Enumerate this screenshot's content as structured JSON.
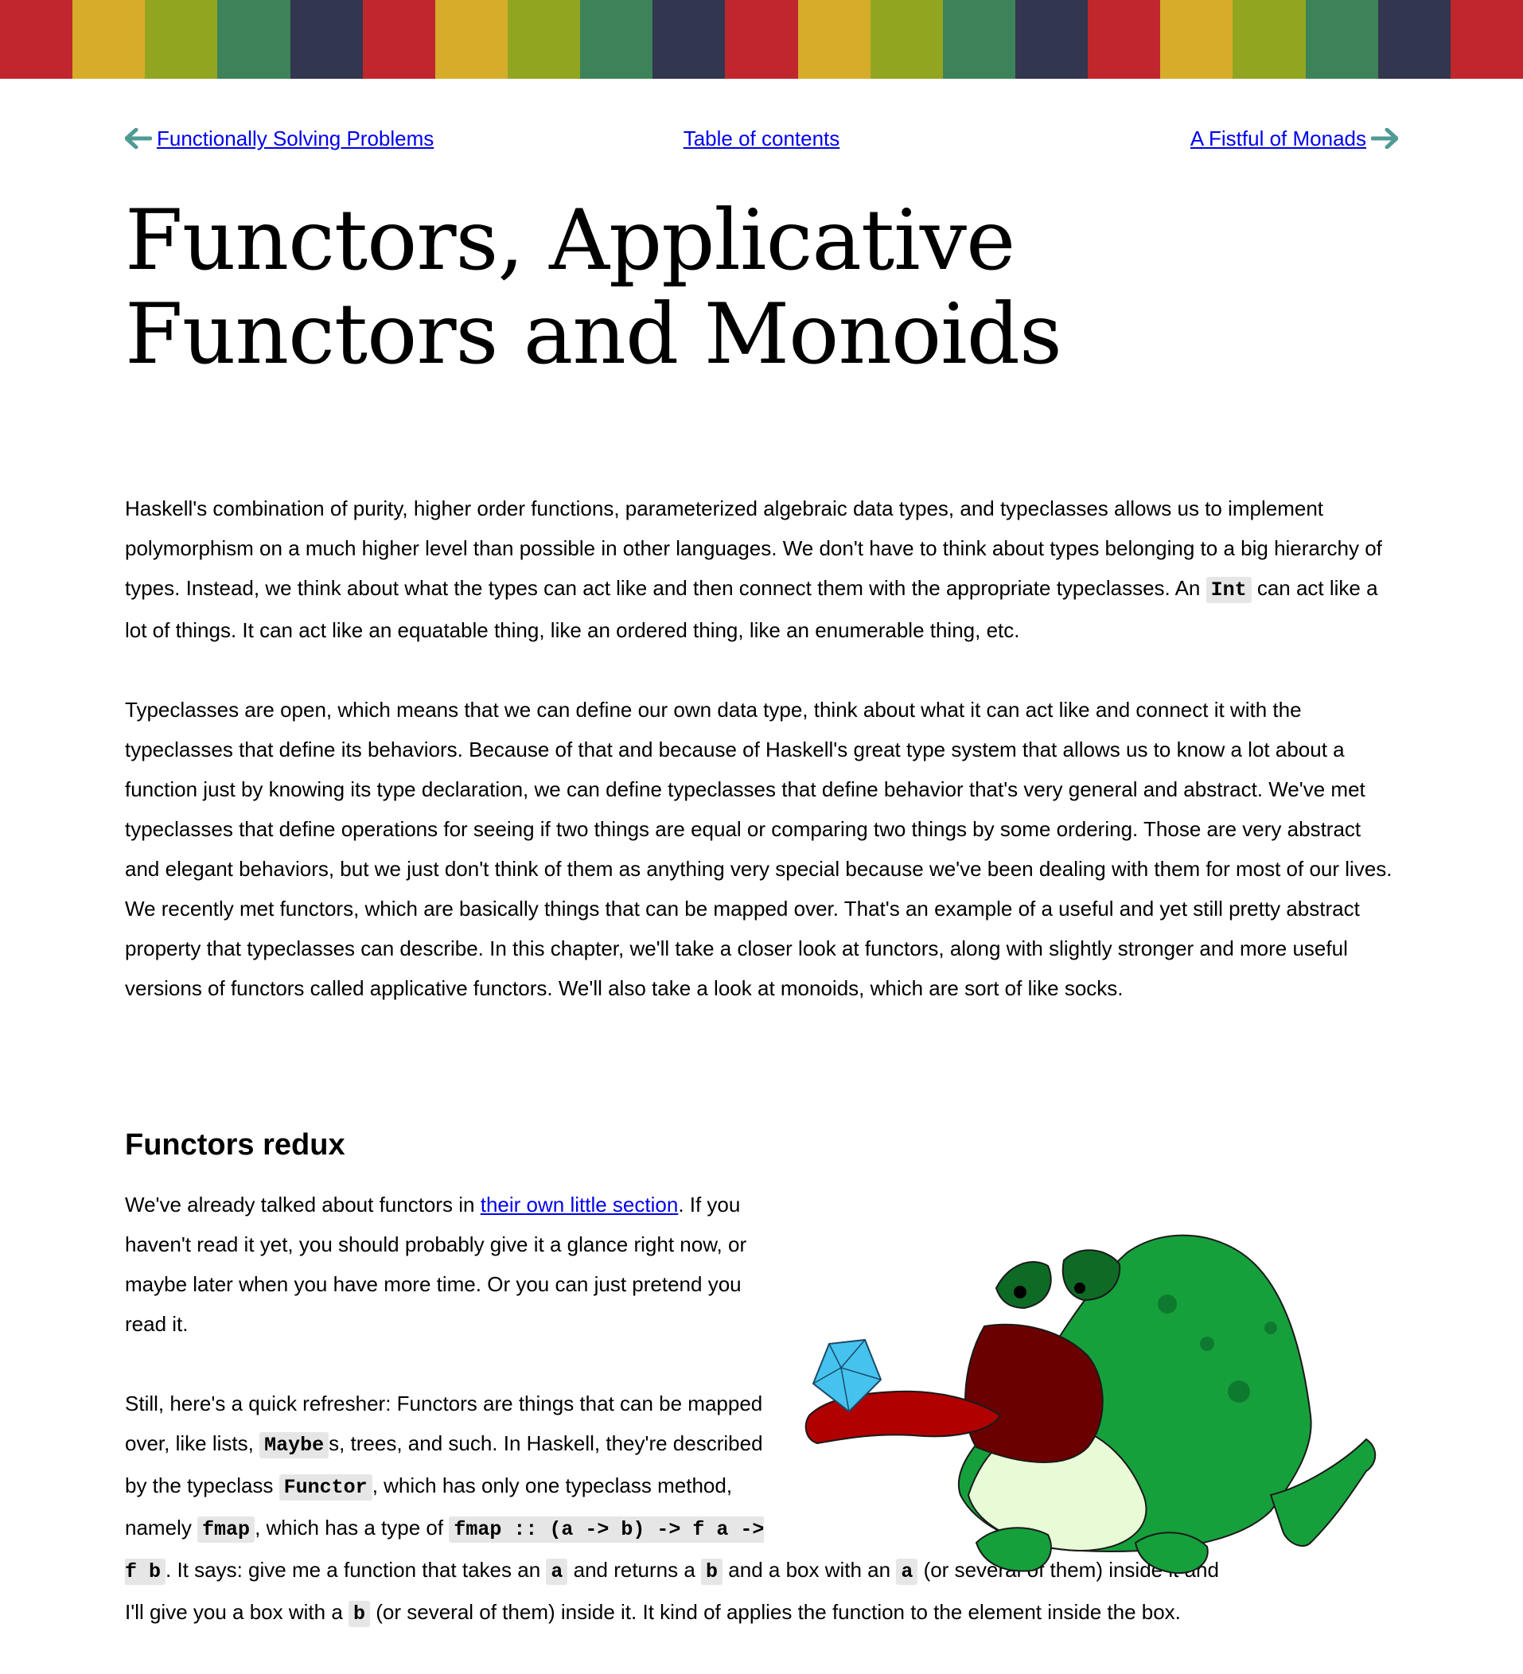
{
  "stripe_colors": [
    "#c0272d",
    "#d6ac2a",
    "#92a521",
    "#3d8359",
    "#32364e",
    "#c0272d",
    "#d6ac2a",
    "#92a521",
    "#3d8359",
    "#32364e",
    "#c0272d",
    "#d6ac2a",
    "#92a521",
    "#3d8359",
    "#32364e",
    "#c0272d",
    "#d6ac2a",
    "#92a521",
    "#3d8359",
    "#32364e",
    "#c0272d"
  ],
  "nav": {
    "prev_label": "Functionally Solving Problems",
    "toc_label": "Table of contents",
    "next_label": "A Fistful of Monads",
    "arrow_color": "#4f9a95"
  },
  "title": {
    "line1": "Functors, Applicative",
    "line2": "Functors and Monoids"
  },
  "intro": {
    "p1_a": "Haskell's combination of purity, higher order functions, parameterized algebraic data types, and typeclasses allows us to implement polymorphism on a much higher level than possible in other languages. We don't have to think about types belonging to a big hierarchy of types. Instead, we think about what the types can act like and then connect them with the appropriate typeclasses. An ",
    "p1_code": "Int",
    "p1_b": " can act like a lot of things. It can act like an equatable thing, like an ordered thing, like an enumerable thing, etc.",
    "p2": "Typeclasses are open, which means that we can define our own data type, think about what it can act like and connect it with the typeclasses that define its behaviors. Because of that and because of Haskell's great type system that allows us to know a lot about a function just by knowing its type declaration, we can define typeclasses that define behavior that's very general and abstract. We've met typeclasses that define operations for seeing if two things are equal or comparing two things by some ordering. Those are very abstract and elegant behaviors, but we just don't think of them as anything very special because we've been dealing with them for most of our lives. We recently met functors, which are basically things that can be mapped over. That's an example of a useful and yet still pretty abstract property that typeclasses can describe. In this chapter, we'll take a closer look at functors, along with slightly stronger and more useful versions of functors called applicative functors. We'll also take a look at monoids, which are sort of like socks."
  },
  "section": {
    "heading": "Functors redux",
    "p1_a": "We've already talked about functors in ",
    "p1_link": "their own little section",
    "p1_b": ". If you haven't read it yet, you should probably give it a glance right now, or maybe later when you have more time. Or you can just pretend you read it.",
    "p2_a": "Still, here's a quick refresher: Functors are things that can be mapped over, like lists, ",
    "code_maybe": "Maybe",
    "p2_b": "s, trees, and such. In Haskell, they're described by the typeclass ",
    "code_functor": "Functor",
    "p2_c": ", which has only one typeclass method, namely ",
    "code_fmap": "fmap",
    "p2_d": ", which has a type of ",
    "code_sig": "fmap :: (a -> b) -> f a -> f b",
    "p2_e": ". It says: give me a function that takes an ",
    "code_a1": "a",
    "p2_f": " and returns a ",
    "code_b1": "b",
    "p2_g": " and a box with an ",
    "code_a2": "a",
    "p2_h": " (or several of them) inside it and I'll give you a box with a ",
    "code_b2": "b",
    "p2_i": " (or several of them) inside it. It kind of applies the function to the element inside the box."
  }
}
